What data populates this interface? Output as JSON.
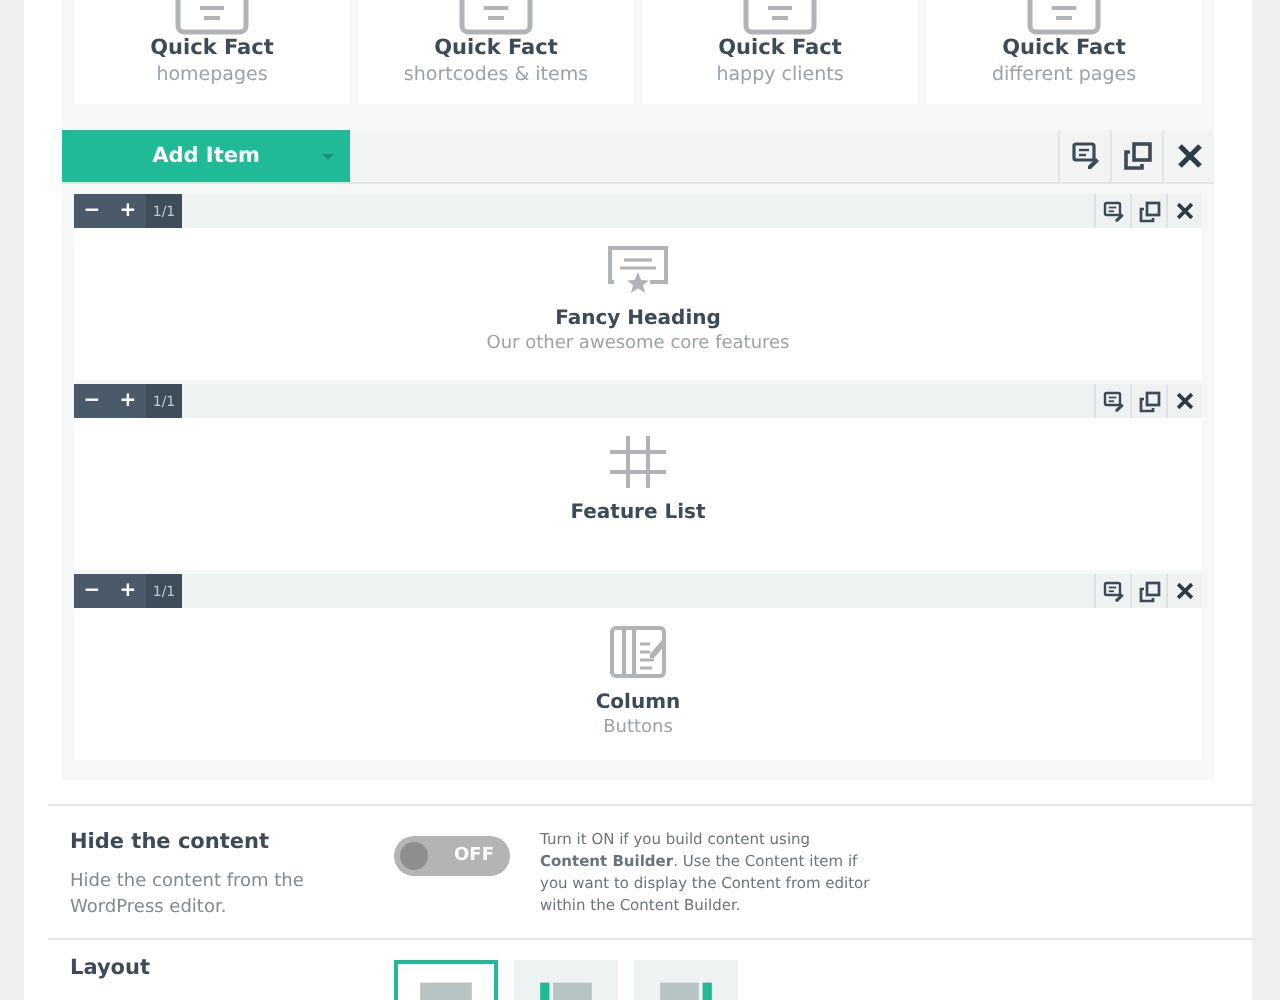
{
  "quick_facts": [
    {
      "title": "Quick Fact",
      "subtitle": "homepages"
    },
    {
      "title": "Quick Fact",
      "subtitle": "shortcodes & items"
    },
    {
      "title": "Quick Fact",
      "subtitle": "happy clients"
    },
    {
      "title": "Quick Fact",
      "subtitle": "different pages"
    }
  ],
  "toolbar": {
    "add_button": "Add Item"
  },
  "items": [
    {
      "kind": "heading",
      "minus": "−",
      "plus": "+",
      "size": "1/1",
      "title": "Fancy Heading",
      "subtitle": "Our other awesome core features"
    },
    {
      "kind": "list",
      "minus": "−",
      "plus": "+",
      "size": "1/1",
      "title": "Feature List"
    },
    {
      "kind": "column",
      "minus": "−",
      "plus": "+",
      "size": "1/1",
      "title": "Column",
      "subtitle": "Buttons"
    }
  ],
  "hide_content": {
    "label": "Hide the content",
    "description": "Hide the content from the WordPress editor.",
    "on": false,
    "toggle_text": "OFF",
    "help": "Turn it ON if you build content using **Content Builder**. Use the Content item if you want to display the Content from editor within the Content Builder."
  },
  "layout": {
    "label": "Layout",
    "options": [
      {
        "kind": "full",
        "selected": true
      },
      {
        "kind": "left",
        "selected": false
      },
      {
        "kind": "right",
        "selected": false
      }
    ]
  }
}
